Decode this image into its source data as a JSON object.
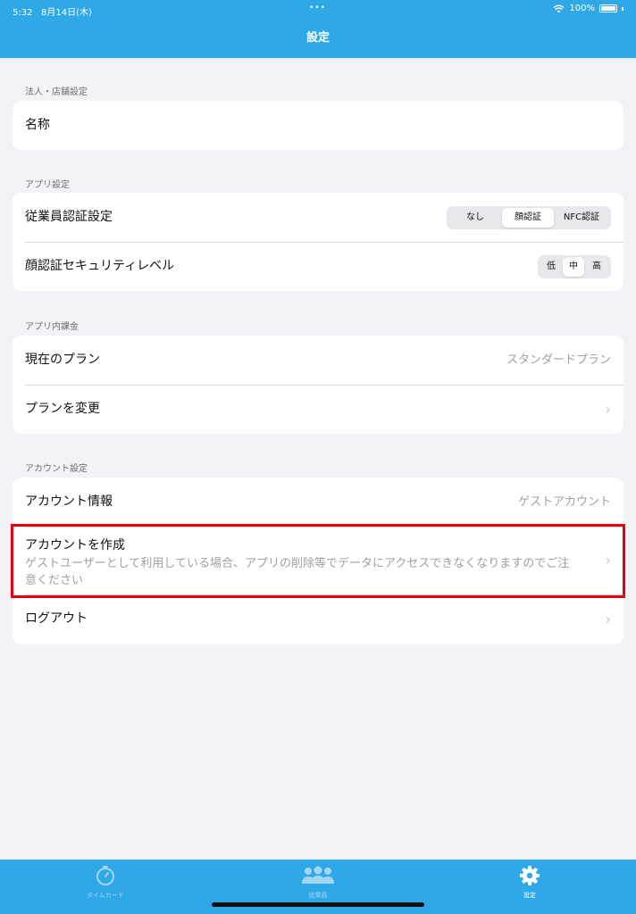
{
  "status_bar": {
    "time": "5:32",
    "date": "8月14日(木)",
    "dots": "•••",
    "battery": "100%"
  },
  "nav": {
    "title": "設定"
  },
  "sections": {
    "corporate": {
      "header": "法人・店舗設定",
      "name_label": "名称"
    },
    "app": {
      "header": "アプリ設定",
      "employee_auth_label": "従業員認証設定",
      "employee_auth_options": [
        "なし",
        "顔認証",
        "NFC認証"
      ],
      "employee_auth_selected": "顔認証",
      "face_security_label": "顔認証セキュリティレベル",
      "face_security_options": [
        "低",
        "中",
        "高"
      ],
      "face_security_selected": "中"
    },
    "billing": {
      "header": "アプリ内課金",
      "current_plan_label": "現在のプラン",
      "current_plan_value": "スタンダードプラン",
      "change_plan_label": "プランを変更"
    },
    "account": {
      "header": "アカウント設定",
      "info_label": "アカウント情報",
      "info_value": "ゲストアカウント",
      "create_label": "アカウントを作成",
      "create_desc": "ゲストユーザーとして利用している場合、アプリの削除等でデータにアクセスできなくなりますのでご注意ください",
      "logout_label": "ログアウト"
    }
  },
  "tabbar": {
    "items": [
      {
        "label": "タイムカード",
        "icon": "timer-icon",
        "selected": false
      },
      {
        "label": "従業員",
        "icon": "people-icon",
        "selected": false
      },
      {
        "label": "設定",
        "icon": "gear-icon",
        "selected": true
      }
    ]
  },
  "colors": {
    "accent": "#2ea8e6",
    "highlight": "#e60012"
  }
}
